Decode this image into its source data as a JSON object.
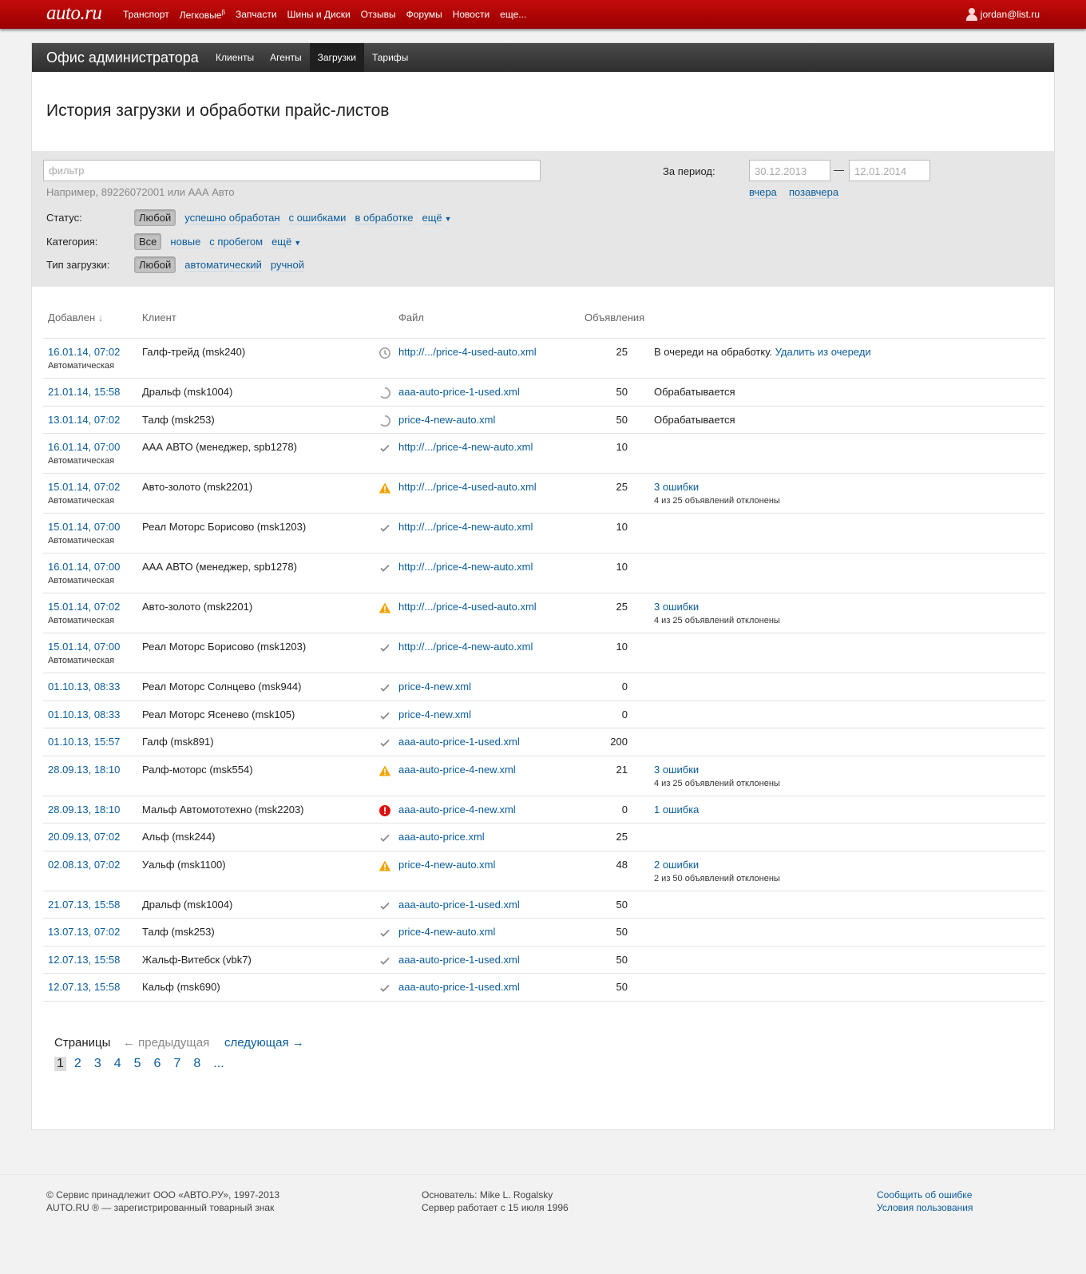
{
  "topbar": {
    "logo": "auto.ru",
    "nav": [
      "Транспорт",
      "Легковые",
      "Запчасти",
      "Шины и Диски",
      "Отзывы",
      "Форумы",
      "Новости",
      "еще..."
    ],
    "nav_beta": "β",
    "user": "jordan@list.ru"
  },
  "office": {
    "title": "Офис администратора",
    "tabs": [
      "Клиенты",
      "Агенты",
      "Загрузки",
      "Тарифы"
    ],
    "active_tab": "Загрузки"
  },
  "page_title": "История загрузки и обработки прайс-листов",
  "filter": {
    "placeholder": "фильтр",
    "example": "Например, 89226072001 или ААА Авто",
    "period_label": "За период:",
    "date_from": "30.12.2013",
    "date_to": "12.01.2014",
    "date_sep": "—",
    "quick": [
      "вчера",
      "позавчера"
    ],
    "status": {
      "label": "Статус:",
      "selected": "Любой",
      "options": [
        "успешно обработан",
        "с ошибками",
        "в обработке",
        "ещё"
      ]
    },
    "category": {
      "label": "Категория:",
      "selected": "Все",
      "options": [
        "новые",
        "с пробегом",
        "ещё"
      ]
    },
    "type": {
      "label": "Тип загрузки:",
      "selected": "Любой",
      "options": [
        "автоматический",
        "ручной"
      ]
    }
  },
  "table": {
    "headers": [
      "Добавлен",
      "Клиент",
      "Файл",
      "Объявления"
    ],
    "sort_arrow": "↓",
    "rows": [
      {
        "date": "16.01.14, 07:02",
        "type": "Автоматическая",
        "client": "Галф-трейд (msk240)",
        "icon": "clock-icon",
        "file": "http://.../price-4-used-auto.xml",
        "count": "25",
        "status": "В очереди на обработку.",
        "status_link": "Удалить из очереди",
        "status_sub": ""
      },
      {
        "date": "21.01.14, 15:58",
        "type": "",
        "client": "Дральф (msk1004)",
        "icon": "spinner-icon",
        "file": "aaa-auto-price-1-used.xml",
        "count": "50",
        "status": "Обрабатывается",
        "status_link": "",
        "status_sub": ""
      },
      {
        "date": "13.01.14, 07:02",
        "type": "",
        "client": "Талф (msk253)",
        "icon": "spinner-icon",
        "file": "price-4-new-auto.xml",
        "count": "50",
        "status": "Обрабатывается",
        "status_link": "",
        "status_sub": ""
      },
      {
        "date": "16.01.14, 07:00",
        "type": "Автоматическая",
        "client": "ААА АВТО (менеджер, spb1278)",
        "icon": "check-icon",
        "file": "http://.../price-4-new-auto.xml",
        "count": "10",
        "status": "",
        "status_link": "",
        "status_sub": ""
      },
      {
        "date": "15.01.14, 07:02",
        "type": "Автоматическая",
        "client": "Авто-золото (msk2201)",
        "icon": "warning-icon",
        "file": "http://.../price-4-used-auto.xml",
        "count": "25",
        "status": "",
        "status_link": "3 ошибки",
        "status_sub": "4 из 25 объявлений отклонены"
      },
      {
        "date": "15.01.14, 07:00",
        "type": "Автоматическая",
        "client": "Реал Моторс Борисово (msk1203)",
        "icon": "check-icon",
        "file": "http://.../price-4-new-auto.xml",
        "count": "10",
        "status": "",
        "status_link": "",
        "status_sub": ""
      },
      {
        "date": "16.01.14, 07:00",
        "type": "Автоматическая",
        "client": "ААА АВТО (менеджер, spb1278)",
        "icon": "check-icon",
        "file": "http://.../price-4-new-auto.xml",
        "count": "10",
        "status": "",
        "status_link": "",
        "status_sub": ""
      },
      {
        "date": "15.01.14, 07:02",
        "type": "Автоматическая",
        "client": "Авто-золото (msk2201)",
        "icon": "warning-icon",
        "file": "http://.../price-4-used-auto.xml",
        "count": "25",
        "status": "",
        "status_link": "3 ошибки",
        "status_sub": "4 из 25 объявлений отклонены"
      },
      {
        "date": "15.01.14, 07:00",
        "type": "Автоматическая",
        "client": "Реал Моторс Борисово (msk1203)",
        "icon": "check-icon",
        "file": "http://.../price-4-new-auto.xml",
        "count": "10",
        "status": "",
        "status_link": "",
        "status_sub": ""
      },
      {
        "date": "01.10.13, 08:33",
        "type": "",
        "client": "Реал Моторс Солнцево (msk944)",
        "icon": "check-icon",
        "file": "price-4-new.xml",
        "count": "0",
        "status": "",
        "status_link": "",
        "status_sub": ""
      },
      {
        "date": "01.10.13, 08:33",
        "type": "",
        "client": "Реал Моторс Ясенево (msk105)",
        "icon": "check-icon",
        "file": "price-4-new.xml",
        "count": "0",
        "status": "",
        "status_link": "",
        "status_sub": ""
      },
      {
        "date": "01.10.13, 15:57",
        "type": "",
        "client": "Галф (msk891)",
        "icon": "check-icon",
        "file": "aaa-auto-price-1-used.xml",
        "count": "200",
        "status": "",
        "status_link": "",
        "status_sub": ""
      },
      {
        "date": "28.09.13, 18:10",
        "type": "",
        "client": "Ралф-моторс (msk554)",
        "icon": "warning-icon",
        "file": "aaa-auto-price-4-new.xml",
        "count": "21",
        "status": "",
        "status_link": "3 ошибки",
        "status_sub": "4 из 25 объявлений отклонены"
      },
      {
        "date": "28.09.13, 18:10",
        "type": "",
        "client": "Мальф Автомототехно (msk2203)",
        "icon": "error-icon",
        "file": "aaa-auto-price-4-new.xml",
        "count": "0",
        "status": "",
        "status_link": "1 ошибка",
        "status_sub": ""
      },
      {
        "date": "20.09.13, 07:02",
        "type": "",
        "client": "Альф (msk244)",
        "icon": "check-icon",
        "file": "aaa-auto-price.xml",
        "count": "25",
        "status": "",
        "status_link": "",
        "status_sub": ""
      },
      {
        "date": "02.08.13, 07:02",
        "type": "",
        "client": "Уальф (msk1100)",
        "icon": "warning-icon",
        "file": "price-4-new-auto.xml",
        "count": "48",
        "status": "",
        "status_link": "2 ошибки",
        "status_sub": "2 из 50 объявлений отклонены"
      },
      {
        "date": "21.07.13, 15:58",
        "type": "",
        "client": "Дральф (msk1004)",
        "icon": "check-icon",
        "file": "aaa-auto-price-1-used.xml",
        "count": "50",
        "status": "",
        "status_link": "",
        "status_sub": ""
      },
      {
        "date": "13.07.13, 07:02",
        "type": "",
        "client": "Талф (msk253)",
        "icon": "check-icon",
        "file": "price-4-new-auto.xml",
        "count": "50",
        "status": "",
        "status_link": "",
        "status_sub": ""
      },
      {
        "date": "12.07.13, 15:58",
        "type": "",
        "client": "Жальф-Витебск (vbk7)",
        "icon": "check-icon",
        "file": "aaa-auto-price-1-used.xml",
        "count": "50",
        "status": "",
        "status_link": "",
        "status_sub": ""
      },
      {
        "date": "12.07.13, 15:58",
        "type": "",
        "client": "Кальф (msk690)",
        "icon": "check-icon",
        "file": "aaa-auto-price-1-used.xml",
        "count": "50",
        "status": "",
        "status_link": "",
        "status_sub": ""
      }
    ]
  },
  "pager": {
    "label": "Страницы",
    "prev": "← предыдущая",
    "next": "следующая →",
    "pages": [
      "1",
      "2",
      "3",
      "4",
      "5",
      "6",
      "7",
      "8",
      "..."
    ],
    "current": "1"
  },
  "footer": {
    "left": [
      "© Сервис принадлежит ООО «АВТО.РУ», 1997-2013",
      "AUTO.RU ® — зарегистрированный товарный знак"
    ],
    "mid": [
      "Основатель: Mike L. Rogalsky",
      "Сервер работает с 15 июля 1996"
    ],
    "right": [
      "Сообщить об ошибке",
      "Условия пользования"
    ]
  },
  "colors": {
    "brand_red": "#b00000",
    "link": "#0a5c9c",
    "warning": "#f0a500",
    "error": "#dd1111",
    "check": "#777777"
  }
}
